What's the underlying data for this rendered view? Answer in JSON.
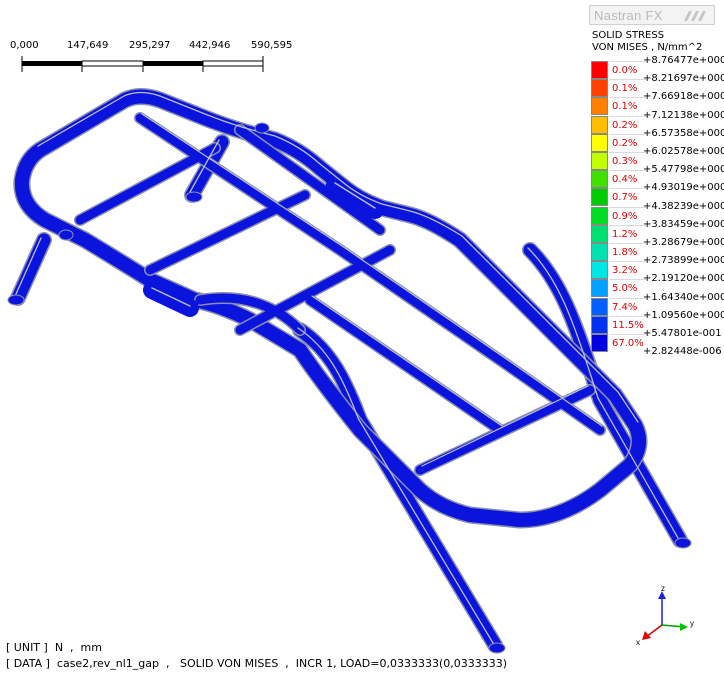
{
  "brand": {
    "name": "Nastran FX"
  },
  "legend": {
    "title_line1": "SOLID STRESS",
    "title_line2": "VON MISES , N/mm^2",
    "levels": [
      "+8.76477e+000",
      "+8.21697e+000",
      "+7.66918e+000",
      "+7.12138e+000",
      "+6.57358e+000",
      "+6.02578e+000",
      "+5.47798e+000",
      "+4.93019e+000",
      "+4.38239e+000",
      "+3.83459e+000",
      "+3.28679e+000",
      "+2.73899e+000",
      "+2.19120e+000",
      "+1.64340e+000",
      "+1.09560e+000",
      "+5.47801e-001",
      "+2.82448e-006"
    ],
    "bands": [
      {
        "pct": "0.0%",
        "color": "#ff0000"
      },
      {
        "pct": "0.1%",
        "color": "#ff4000"
      },
      {
        "pct": "0.1%",
        "color": "#ff8000"
      },
      {
        "pct": "0.2%",
        "color": "#ffbf00"
      },
      {
        "pct": "0.2%",
        "color": "#ffff00"
      },
      {
        "pct": "0.3%",
        "color": "#bfff00"
      },
      {
        "pct": "0.4%",
        "color": "#40e000"
      },
      {
        "pct": "0.7%",
        "color": "#00cc00"
      },
      {
        "pct": "0.9%",
        "color": "#00dd22"
      },
      {
        "pct": "1.2%",
        "color": "#00e070"
      },
      {
        "pct": "1.8%",
        "color": "#00e0b0"
      },
      {
        "pct": "3.2%",
        "color": "#00e5e5"
      },
      {
        "pct": "5.0%",
        "color": "#00a0ff"
      },
      {
        "pct": "7.4%",
        "color": "#0060ff"
      },
      {
        "pct": "11.5%",
        "color": "#0030f0"
      },
      {
        "pct": "67.0%",
        "color": "#0000e0"
      }
    ]
  },
  "scale_bar": {
    "labels": [
      "0,000",
      "147,649",
      "295,297",
      "442,946",
      "590,595"
    ]
  },
  "axis": {
    "x": "x",
    "y": "y",
    "z": "z"
  },
  "footer": {
    "unit_line": "[ UNIT ]  N  ,  mm",
    "data_line": "[ DATA ]  case2,rev_nl1_gap  ,   SOLID VON MISES  ,  INCR 1, LOAD=0,0333333(0,0333333)"
  },
  "colors": {
    "tube": "#0a14dc",
    "highlight": "#b9bed2",
    "background": "#ffffff"
  }
}
